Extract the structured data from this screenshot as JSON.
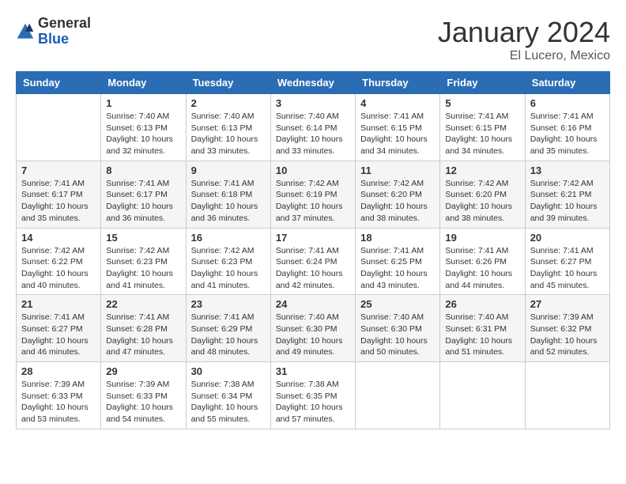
{
  "header": {
    "logo_general": "General",
    "logo_blue": "Blue",
    "month_title": "January 2024",
    "location": "El Lucero, Mexico"
  },
  "weekdays": [
    "Sunday",
    "Monday",
    "Tuesday",
    "Wednesday",
    "Thursday",
    "Friday",
    "Saturday"
  ],
  "weeks": [
    [
      {
        "day": "",
        "sunrise": "",
        "sunset": "",
        "daylight": ""
      },
      {
        "day": "1",
        "sunrise": "Sunrise: 7:40 AM",
        "sunset": "Sunset: 6:13 PM",
        "daylight": "Daylight: 10 hours and 32 minutes."
      },
      {
        "day": "2",
        "sunrise": "Sunrise: 7:40 AM",
        "sunset": "Sunset: 6:13 PM",
        "daylight": "Daylight: 10 hours and 33 minutes."
      },
      {
        "day": "3",
        "sunrise": "Sunrise: 7:40 AM",
        "sunset": "Sunset: 6:14 PM",
        "daylight": "Daylight: 10 hours and 33 minutes."
      },
      {
        "day": "4",
        "sunrise": "Sunrise: 7:41 AM",
        "sunset": "Sunset: 6:15 PM",
        "daylight": "Daylight: 10 hours and 34 minutes."
      },
      {
        "day": "5",
        "sunrise": "Sunrise: 7:41 AM",
        "sunset": "Sunset: 6:15 PM",
        "daylight": "Daylight: 10 hours and 34 minutes."
      },
      {
        "day": "6",
        "sunrise": "Sunrise: 7:41 AM",
        "sunset": "Sunset: 6:16 PM",
        "daylight": "Daylight: 10 hours and 35 minutes."
      }
    ],
    [
      {
        "day": "7",
        "sunrise": "Sunrise: 7:41 AM",
        "sunset": "Sunset: 6:17 PM",
        "daylight": "Daylight: 10 hours and 35 minutes."
      },
      {
        "day": "8",
        "sunrise": "Sunrise: 7:41 AM",
        "sunset": "Sunset: 6:17 PM",
        "daylight": "Daylight: 10 hours and 36 minutes."
      },
      {
        "day": "9",
        "sunrise": "Sunrise: 7:41 AM",
        "sunset": "Sunset: 6:18 PM",
        "daylight": "Daylight: 10 hours and 36 minutes."
      },
      {
        "day": "10",
        "sunrise": "Sunrise: 7:42 AM",
        "sunset": "Sunset: 6:19 PM",
        "daylight": "Daylight: 10 hours and 37 minutes."
      },
      {
        "day": "11",
        "sunrise": "Sunrise: 7:42 AM",
        "sunset": "Sunset: 6:20 PM",
        "daylight": "Daylight: 10 hours and 38 minutes."
      },
      {
        "day": "12",
        "sunrise": "Sunrise: 7:42 AM",
        "sunset": "Sunset: 6:20 PM",
        "daylight": "Daylight: 10 hours and 38 minutes."
      },
      {
        "day": "13",
        "sunrise": "Sunrise: 7:42 AM",
        "sunset": "Sunset: 6:21 PM",
        "daylight": "Daylight: 10 hours and 39 minutes."
      }
    ],
    [
      {
        "day": "14",
        "sunrise": "Sunrise: 7:42 AM",
        "sunset": "Sunset: 6:22 PM",
        "daylight": "Daylight: 10 hours and 40 minutes."
      },
      {
        "day": "15",
        "sunrise": "Sunrise: 7:42 AM",
        "sunset": "Sunset: 6:23 PM",
        "daylight": "Daylight: 10 hours and 41 minutes."
      },
      {
        "day": "16",
        "sunrise": "Sunrise: 7:42 AM",
        "sunset": "Sunset: 6:23 PM",
        "daylight": "Daylight: 10 hours and 41 minutes."
      },
      {
        "day": "17",
        "sunrise": "Sunrise: 7:41 AM",
        "sunset": "Sunset: 6:24 PM",
        "daylight": "Daylight: 10 hours and 42 minutes."
      },
      {
        "day": "18",
        "sunrise": "Sunrise: 7:41 AM",
        "sunset": "Sunset: 6:25 PM",
        "daylight": "Daylight: 10 hours and 43 minutes."
      },
      {
        "day": "19",
        "sunrise": "Sunrise: 7:41 AM",
        "sunset": "Sunset: 6:26 PM",
        "daylight": "Daylight: 10 hours and 44 minutes."
      },
      {
        "day": "20",
        "sunrise": "Sunrise: 7:41 AM",
        "sunset": "Sunset: 6:27 PM",
        "daylight": "Daylight: 10 hours and 45 minutes."
      }
    ],
    [
      {
        "day": "21",
        "sunrise": "Sunrise: 7:41 AM",
        "sunset": "Sunset: 6:27 PM",
        "daylight": "Daylight: 10 hours and 46 minutes."
      },
      {
        "day": "22",
        "sunrise": "Sunrise: 7:41 AM",
        "sunset": "Sunset: 6:28 PM",
        "daylight": "Daylight: 10 hours and 47 minutes."
      },
      {
        "day": "23",
        "sunrise": "Sunrise: 7:41 AM",
        "sunset": "Sunset: 6:29 PM",
        "daylight": "Daylight: 10 hours and 48 minutes."
      },
      {
        "day": "24",
        "sunrise": "Sunrise: 7:40 AM",
        "sunset": "Sunset: 6:30 PM",
        "daylight": "Daylight: 10 hours and 49 minutes."
      },
      {
        "day": "25",
        "sunrise": "Sunrise: 7:40 AM",
        "sunset": "Sunset: 6:30 PM",
        "daylight": "Daylight: 10 hours and 50 minutes."
      },
      {
        "day": "26",
        "sunrise": "Sunrise: 7:40 AM",
        "sunset": "Sunset: 6:31 PM",
        "daylight": "Daylight: 10 hours and 51 minutes."
      },
      {
        "day": "27",
        "sunrise": "Sunrise: 7:39 AM",
        "sunset": "Sunset: 6:32 PM",
        "daylight": "Daylight: 10 hours and 52 minutes."
      }
    ],
    [
      {
        "day": "28",
        "sunrise": "Sunrise: 7:39 AM",
        "sunset": "Sunset: 6:33 PM",
        "daylight": "Daylight: 10 hours and 53 minutes."
      },
      {
        "day": "29",
        "sunrise": "Sunrise: 7:39 AM",
        "sunset": "Sunset: 6:33 PM",
        "daylight": "Daylight: 10 hours and 54 minutes."
      },
      {
        "day": "30",
        "sunrise": "Sunrise: 7:38 AM",
        "sunset": "Sunset: 6:34 PM",
        "daylight": "Daylight: 10 hours and 55 minutes."
      },
      {
        "day": "31",
        "sunrise": "Sunrise: 7:38 AM",
        "sunset": "Sunset: 6:35 PM",
        "daylight": "Daylight: 10 hours and 57 minutes."
      },
      {
        "day": "",
        "sunrise": "",
        "sunset": "",
        "daylight": ""
      },
      {
        "day": "",
        "sunrise": "",
        "sunset": "",
        "daylight": ""
      },
      {
        "day": "",
        "sunrise": "",
        "sunset": "",
        "daylight": ""
      }
    ]
  ]
}
